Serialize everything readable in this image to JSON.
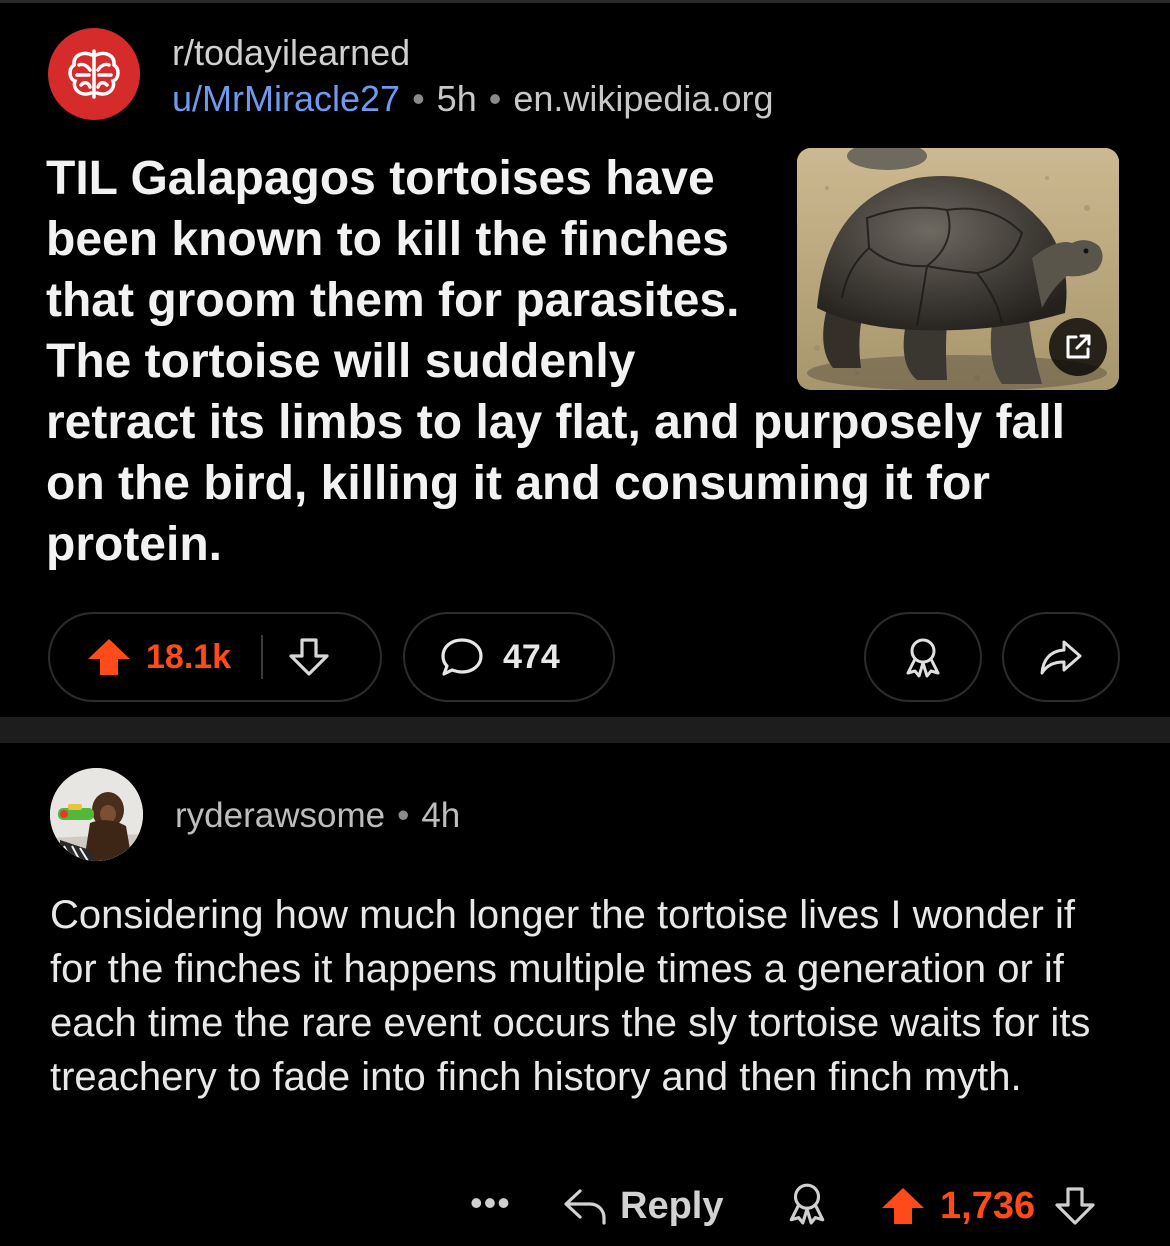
{
  "post": {
    "subreddit": "r/todayilearned",
    "author": "u/MrMiracle27",
    "age": "5h",
    "domain": "en.wikipedia.org",
    "title": "TIL Galapagos tortoises have been known to kill the finches that groom them for parasites. The tortoise will suddenly retract its limbs to lay flat, and purposely fall on the bird, killing it and consuming it for protein.",
    "score": "18.1k",
    "comments": "474",
    "separator": "•"
  },
  "comment": {
    "author": "ryderawsome",
    "age": "4h",
    "separator": "•",
    "body": "Considering how much longer the tortoise lives I wonder if for the finches it happens multiple times a generation or if each time the rare event occurs the sly tortoise waits for its treachery to fade into finch history and then finch myth.",
    "more_label": "•••",
    "reply_label": "Reply",
    "score": "1,736"
  },
  "colors": {
    "upvote": "#ff4a1a",
    "username": "#6f99ee",
    "subreddit_avatar": "#d52b2b"
  },
  "icons": {
    "subreddit_avatar": "brain-icon",
    "upvote": "upvote-arrow-icon",
    "downvote": "downvote-arrow-icon",
    "comment": "speech-bubble-icon",
    "award": "award-icon",
    "share": "share-arrow-icon",
    "external_link": "external-link-icon",
    "reply": "reply-arrow-icon"
  }
}
